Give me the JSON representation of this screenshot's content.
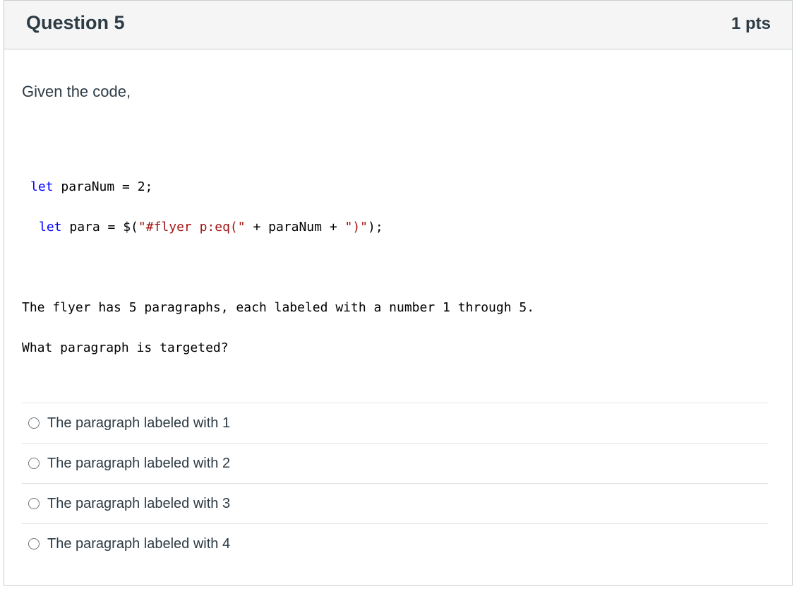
{
  "header": {
    "title": "Question 5",
    "points": "1 pts"
  },
  "body": {
    "intro": "Given the code,",
    "code": {
      "line1": {
        "keyword": "let",
        "rest": " paraNum = 2;"
      },
      "line2": {
        "keyword": "let",
        "part1": " para = $(",
        "string1": "\"#flyer p:eq(\"",
        "part2": " + paraNum + ",
        "string2": "\")\"",
        "part3": ");"
      }
    },
    "description": "The flyer has 5 paragraphs, each labeled with a number 1 through 5.",
    "prompt": "What paragraph is targeted?"
  },
  "answers": [
    {
      "label": "The paragraph labeled with 1",
      "selected": false
    },
    {
      "label": "The paragraph labeled with 2",
      "selected": false
    },
    {
      "label": "The paragraph labeled with 3",
      "selected": false
    },
    {
      "label": "The paragraph labeled with 4",
      "selected": false
    }
  ]
}
